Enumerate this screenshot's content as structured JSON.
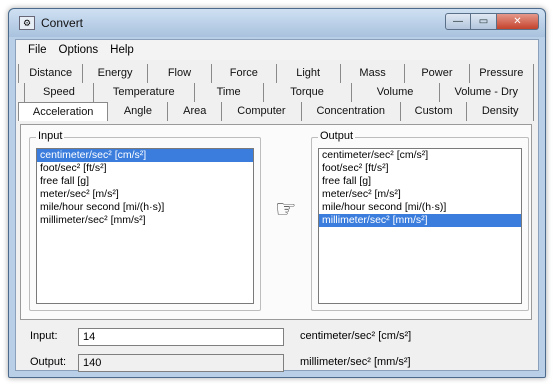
{
  "window": {
    "title": "Convert",
    "icon": "converter-icon"
  },
  "window_controls": {
    "minimize": "—",
    "maximize": "▭",
    "close": "✕"
  },
  "menu": [
    "File",
    "Options",
    "Help"
  ],
  "tabs": {
    "row1": [
      "Distance",
      "Energy",
      "Flow",
      "Force",
      "Light",
      "Mass",
      "Power",
      "Pressure"
    ],
    "row2": [
      "Speed",
      "Temperature",
      "Time",
      "Torque",
      "Volume",
      "Volume - Dry"
    ],
    "row3": [
      "Acceleration",
      "Angle",
      "Area",
      "Computer",
      "Concentration",
      "Custom",
      "Density"
    ],
    "active": "Acceleration"
  },
  "input_group": {
    "label": "Input",
    "items": [
      "centimeter/sec² [cm/s²]",
      "foot/sec² [ft/s²]",
      "free fall [g]",
      "meter/sec² [m/s²]",
      "mile/hour second [mi/(h·s)]",
      "millimeter/sec² [mm/s²]"
    ],
    "selected_index": 0
  },
  "output_group": {
    "label": "Output",
    "items": [
      "centimeter/sec² [cm/s²]",
      "foot/sec² [ft/s²]",
      "free fall [g]",
      "meter/sec² [m/s²]",
      "mile/hour second [mi/(h·s)]",
      "millimeter/sec² [mm/s²]"
    ],
    "selected_index": 5
  },
  "convert_arrow": {
    "icon": "pointing-hand-icon",
    "glyph": "☞"
  },
  "input_row": {
    "label": "Input:",
    "value": "14",
    "unit": "centimeter/sec² [cm/s²]"
  },
  "output_row": {
    "label": "Output:",
    "value": "140",
    "unit": "millimeter/sec² [mm/s²]"
  }
}
